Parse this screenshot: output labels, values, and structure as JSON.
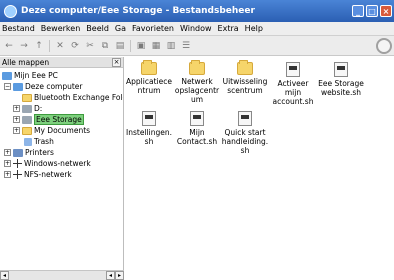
{
  "window": {
    "title": "Deze computer/Eee Storage - Bestandsbeheer",
    "buttons": {
      "minimize": "_",
      "maximize": "□",
      "close": "×"
    }
  },
  "menu": [
    "Bestand",
    "Bewerken",
    "Beeld",
    "Ga",
    "Favorieten",
    "Window",
    "Extra",
    "Help"
  ],
  "toolbar": {
    "back": "←",
    "forward": "→",
    "up": "↑",
    "stop": "✕",
    "reload": "⟳",
    "cut": "✂",
    "copy": "⧉",
    "paste": "▤",
    "properties": "▣",
    "view_icons": "▦",
    "view_list": "▥",
    "view_detail": "☰"
  },
  "sidebar": {
    "title": "Alle mappen",
    "close": "×",
    "tree": [
      {
        "label": "Mijn Eee PC",
        "icon": "home"
      },
      {
        "label": "Deze computer",
        "icon": "home"
      },
      {
        "label": "Bluetooth Exchange Fold",
        "icon": "folder"
      },
      {
        "label": "D:",
        "icon": "drive"
      },
      {
        "label": "Eee Storage",
        "icon": "drive"
      },
      {
        "label": "My Documents",
        "icon": "folder"
      },
      {
        "label": "Trash",
        "icon": "trash"
      },
      {
        "label": "Printers",
        "icon": "printer"
      },
      {
        "label": "Windows-netwerk",
        "icon": "network"
      },
      {
        "label": "NFS-netwerk",
        "icon": "network"
      }
    ],
    "expanders": {
      "open": "−",
      "closed": "+"
    },
    "scroll": {
      "left": "◂",
      "right": "▸"
    }
  },
  "files": [
    {
      "name": "Applicatiecentrum",
      "type": "folder",
      "label": "Applicatiece ntrum"
    },
    {
      "name": "Netwerk opslagcentrum",
      "type": "folder",
      "label": "Netwerk opslagcentr um"
    },
    {
      "name": "Uitwisselingscentrum",
      "type": "folder",
      "label": "Uitwisseling scentrum"
    },
    {
      "name": "Activeer mijn account.sh",
      "type": "script",
      "label": "Activeer mijn account.sh"
    },
    {
      "name": "Eee Storage website.sh",
      "type": "script",
      "label": "Eee Storage website.sh"
    },
    {
      "name": "Instellingen.sh",
      "type": "script",
      "label": "Instellingen. sh"
    },
    {
      "name": "Mijn Contact.sh",
      "type": "script",
      "label": "Mijn Contact.sh"
    },
    {
      "name": "Quick start handleiding.sh",
      "type": "script",
      "label": "Quick start handleiding. sh"
    }
  ]
}
